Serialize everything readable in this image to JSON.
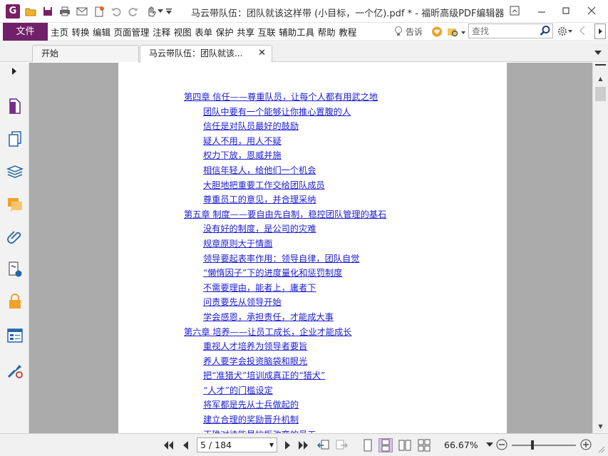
{
  "window": {
    "title": "马云带队伍：团队就该这样带 (小目标，一个亿).pdf * - 福昕高级PDF编辑器",
    "logo_letter": "G"
  },
  "menu": {
    "file": "文件",
    "items": [
      "主页",
      "转换",
      "编辑",
      "页面管理",
      "注释",
      "视图",
      "表单",
      "保护",
      "共享",
      "互联",
      "辅助工具",
      "帮助",
      "教程"
    ],
    "tell_me": "告诉",
    "search_placeholder": "查找"
  },
  "tabs": [
    {
      "label": "开始"
    },
    {
      "label": "马云带队伍：团队就该..."
    }
  ],
  "toc": [
    {
      "text": "第四章 信任——尊重队员，让每个人都有用武之地",
      "level": 0
    },
    {
      "text": "团队中要有一个能够让你推心置腹的人",
      "level": 1
    },
    {
      "text": "信任是对队员最好的鼓励",
      "level": 1
    },
    {
      "text": "疑人不用，用人不疑",
      "level": 1
    },
    {
      "text": "权力下放，恩威并施",
      "level": 1
    },
    {
      "text": "相信年轻人，给他们一个机会",
      "level": 1
    },
    {
      "text": "大胆地把重要工作交给团队成员",
      "level": 1
    },
    {
      "text": "尊重员工的意见，并合理采纳",
      "level": 1
    },
    {
      "text": "第五章 制度——要自由先自制，稳控团队管理的基石",
      "level": 0
    },
    {
      "text": "没有好的制度，是公司的灾难",
      "level": 1
    },
    {
      "text": "规章原则大于情面",
      "level": 1
    },
    {
      "text": "领导要起表率作用：领导自律，团队自觉",
      "level": 1
    },
    {
      "text": "“懒惰因子”下的进度量化和惩罚制度",
      "level": 1
    },
    {
      "text": "不需要理由，能者上，庸者下",
      "level": 1
    },
    {
      "text": "问责要先从领导开始",
      "level": 1
    },
    {
      "text": "学会感恩，承担责任，才能成大事",
      "level": 1
    },
    {
      "text": "第六章 培养——让员工成长，企业才能成长",
      "level": 0
    },
    {
      "text": "重视人才培养为领导者要旨",
      "level": 1
    },
    {
      "text": "养人要学会投资脑袋和眼光",
      "level": 1
    },
    {
      "text": "把“准猎犬”培训成真正的“猎犬”",
      "level": 1
    },
    {
      "text": "“人才”的门槛设定",
      "level": 1
    },
    {
      "text": "将军都是先从士兵做起的",
      "level": 1
    },
    {
      "text": "建立合理的奖励晋升机制",
      "level": 1
    },
    {
      "text": "正确对待能最抗拒改变的员工",
      "level": 1
    }
  ],
  "status": {
    "page": "5 / 184",
    "zoom": "66.67%",
    "zoom_fraction": 0.3
  },
  "colors": {
    "brand": "#70216a",
    "link": "#1c1cd6",
    "doc_background": "#ababab",
    "accent_orange": "#f0a22a"
  }
}
